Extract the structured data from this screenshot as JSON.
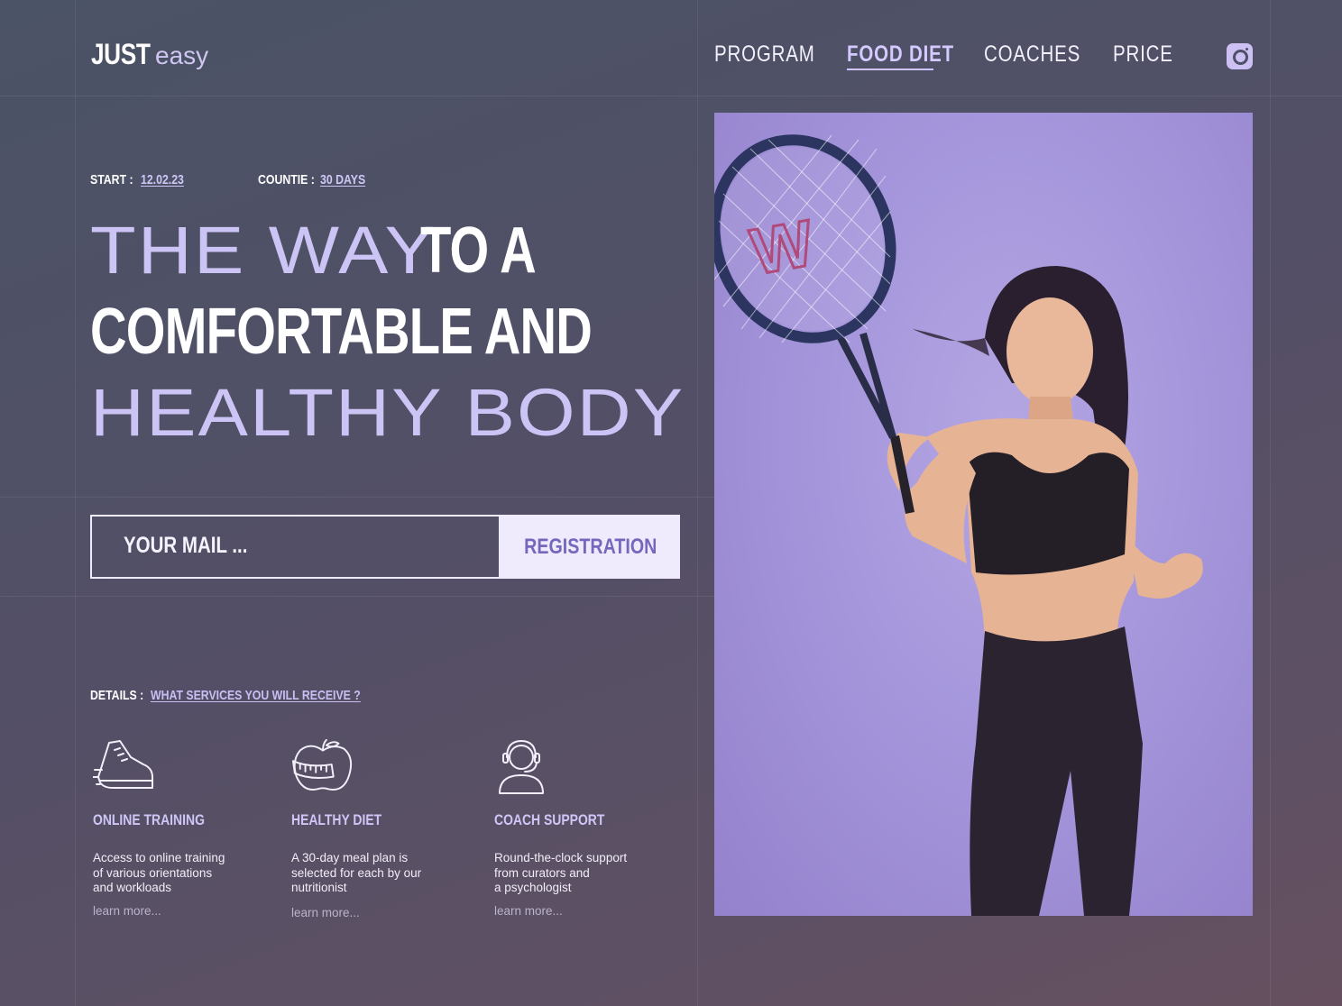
{
  "brand": {
    "bold": "JUST",
    "light": "easy"
  },
  "nav": {
    "items": [
      {
        "label": "PROGRAM",
        "active": false
      },
      {
        "label": "FOOD DIET",
        "active": true
      },
      {
        "label": "COACHES",
        "active": false
      },
      {
        "label": "PRICE",
        "active": false
      }
    ],
    "social_icon": "instagram-icon"
  },
  "meta": {
    "start_label": "START :",
    "start_value": "12.02.23",
    "count_label": "COUNTIE :",
    "count_value": "30 DAYS"
  },
  "headline": {
    "line1_light": "THE WAY",
    "line1_bold": "TO A",
    "line2_bold": "COMFORTABLE AND",
    "line3_light": "HEALTHY BODY"
  },
  "form": {
    "mail_placeholder": "YOUR MAIL ...",
    "button_label": "REGISTRATION"
  },
  "details": {
    "label": "DETAILS :",
    "link": "WHAT SERVICES YOU WILL RECEIVE ?"
  },
  "services": [
    {
      "icon": "sneaker-icon",
      "title": "ONLINE TRAINING",
      "desc": "Access to online training\nof various orientations\nand workloads",
      "more": "learn more..."
    },
    {
      "icon": "apple-measuring-tape-icon",
      "title": "HEALTHY DIET",
      "desc": "A 30-day meal plan is\nselected for each  by our\nnutritionist",
      "more": "learn more..."
    },
    {
      "icon": "headset-person-icon",
      "title": "COACH SUPPORT",
      "desc": "Round-the-clock support\nfrom curators and\na psychologist",
      "more": "learn more..."
    }
  ],
  "colors": {
    "accent_light": "#cdc4f6",
    "button_bg": "#efebfd",
    "button_text": "#7567bc",
    "photo_bg": "#a596dc"
  }
}
